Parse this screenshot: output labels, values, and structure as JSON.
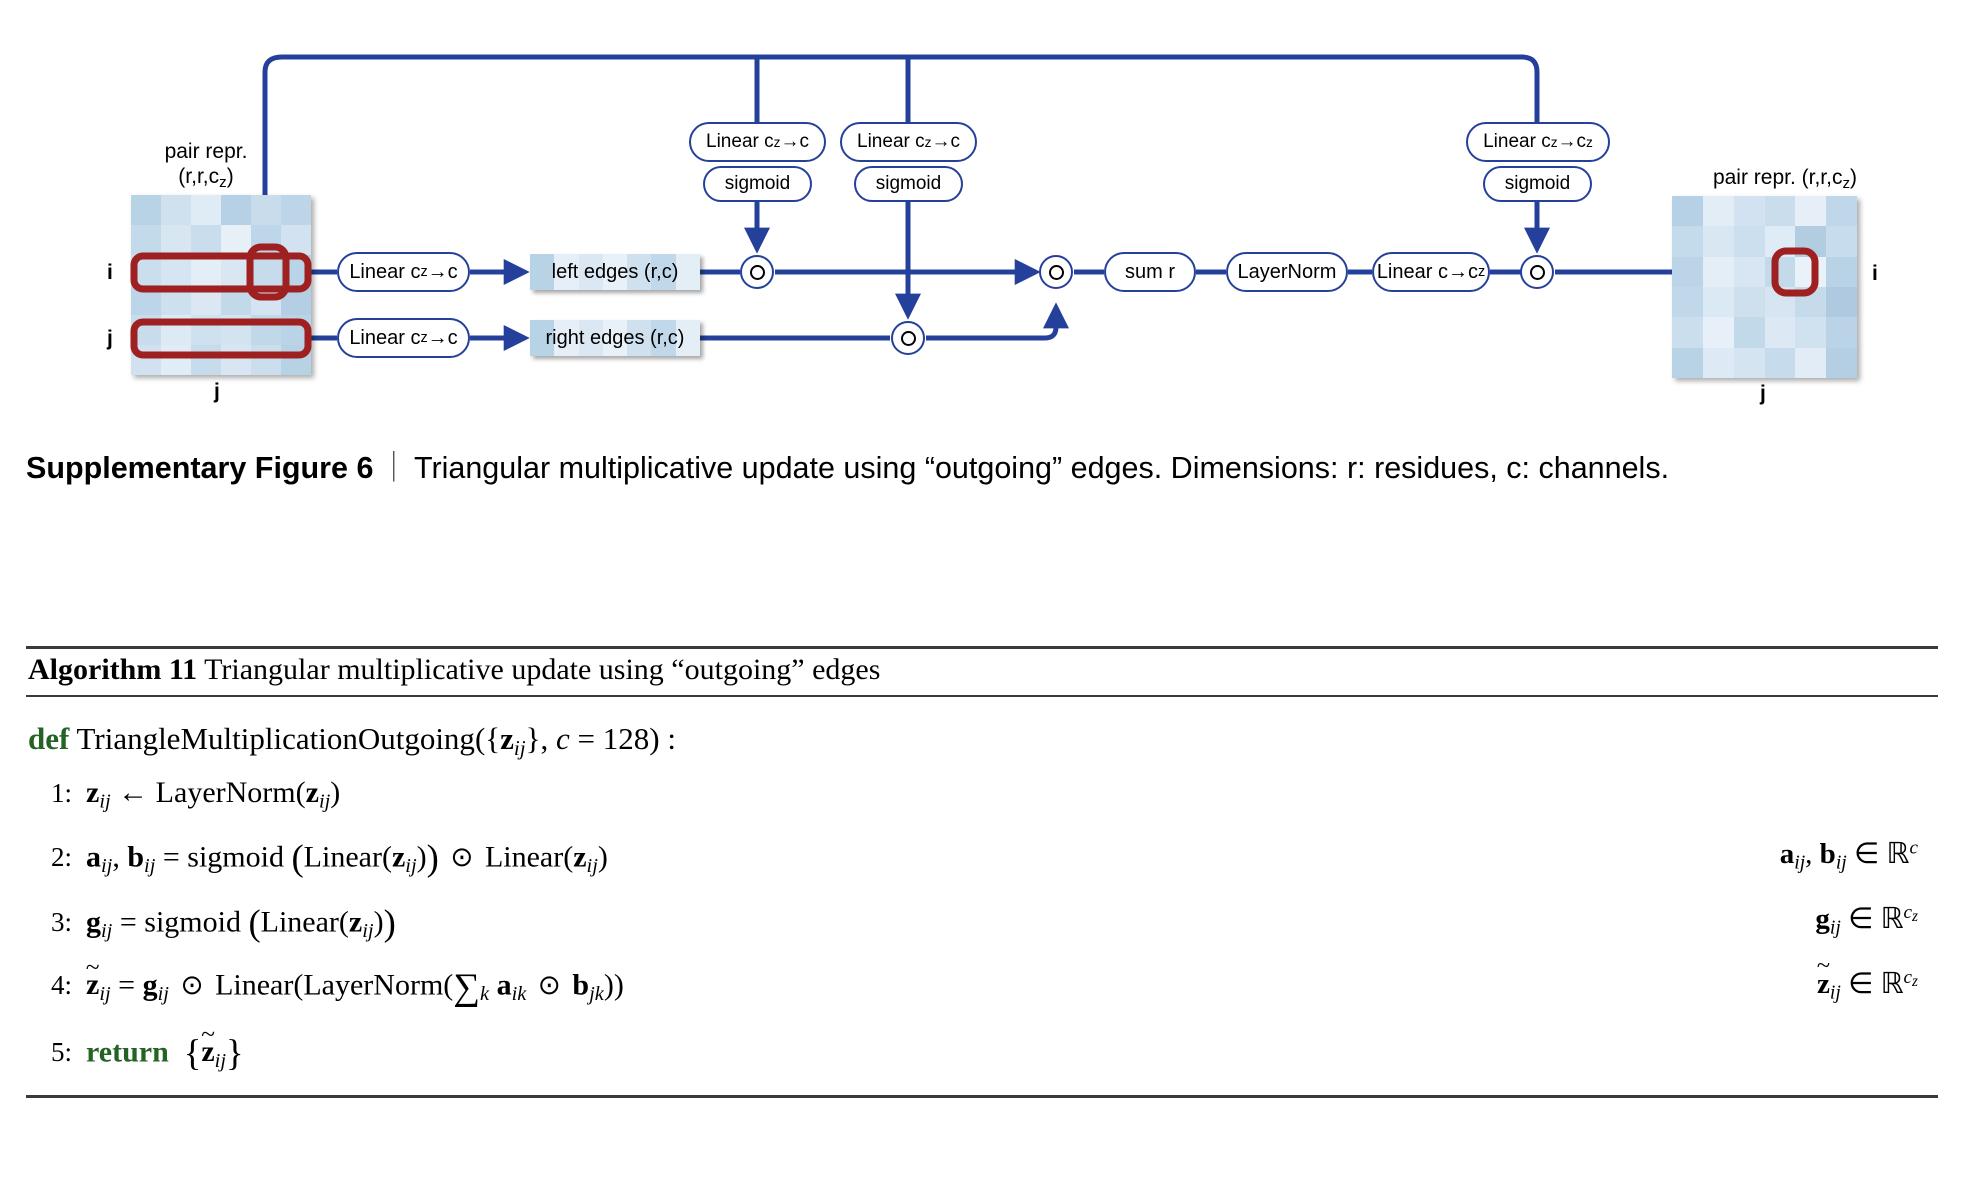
{
  "figure": {
    "diagram": {
      "input_matrix": {
        "title_line1": "pair repr.",
        "title_line2": "(r,r,c",
        "title_sub": "z",
        "title_close": ")",
        "row_label_i": "i",
        "row_label_j": "j",
        "col_label": "j"
      },
      "output_matrix": {
        "title": "pair repr. (r,r,c",
        "title_sub": "z",
        "title_close": ")",
        "row_label_i": "i",
        "col_label": "j"
      },
      "nodes": {
        "linear_left": "Linear c",
        "linear_left_sub": "z",
        "linear_left_tail": "→c",
        "linear_right": "Linear c",
        "linear_right_sub": "z",
        "linear_right_tail": "→c",
        "gate_linear_1": "Linear c",
        "gate_linear_1_sub": "z",
        "gate_linear_1_tail": "→c",
        "gate_linear_2": "Linear c",
        "gate_linear_2_sub": "z",
        "gate_linear_2_tail": "→c",
        "gate_linear_3": "Linear c",
        "gate_linear_3_sub": "z",
        "gate_linear_3_tail": "→c",
        "gate_linear_3_tail_sub": "z",
        "sigmoid_1": "sigmoid",
        "sigmoid_2": "sigmoid",
        "sigmoid_3": "sigmoid",
        "left_edges": "left edges (r,c)",
        "right_edges": "right edges (r,c)",
        "sum_r": "sum r",
        "layernorm": "LayerNorm",
        "linear_out": "Linear c→c",
        "linear_out_sub": "z"
      },
      "colors": {
        "line": "#24409a",
        "highlight": "#9e2020",
        "cell_light": "#e8f0f8",
        "cell_mid": "#c7dceb",
        "cell_dark": "#a9c9df"
      },
      "input_cells": [
        [
          "#b9d3e6",
          "#cfe1ef",
          "#dfebf5",
          "#b6d1e5",
          "#c8dcec",
          "#bdd5e8"
        ],
        [
          "#c3daea",
          "#d8e6f2",
          "#c9dded",
          "#e7f0f7",
          "#bed6e9",
          "#d2e2f0"
        ],
        [
          "#cadeee",
          "#d6e5f2",
          "#e4eef6",
          "#d9e7f3",
          "#c6dbeb",
          "#bad4e7"
        ],
        [
          "#bdd5e8",
          "#cde0ee",
          "#dbe8f4",
          "#c2d9ea",
          "#d5e4f1",
          "#b4cfe3"
        ],
        [
          "#c8dcec",
          "#ddeaf4",
          "#cfe1ef",
          "#d4e3f0",
          "#c1d8e9",
          "#bbd3e7"
        ],
        [
          "#d1e1ef",
          "#e0ecf6",
          "#c6dbeb",
          "#d7e6f2",
          "#cbdeed",
          "#b7d2e5"
        ]
      ],
      "output_cells": [
        [
          "#b6d1e5",
          "#e2edf6",
          "#d3e2f0",
          "#c9ddec",
          "#e6eff7",
          "#bfd7e9"
        ],
        [
          "#c4dbeb",
          "#d9e7f3",
          "#ccdfee",
          "#dfebf5",
          "#b2cde2",
          "#c7dcec"
        ],
        [
          "#bcd4e7",
          "#e4eef6",
          "#d7e6f2",
          "#c3daea",
          "#eaf2f9",
          "#b9d3e6"
        ],
        [
          "#c0d8e9",
          "#dbe9f4",
          "#cedfee",
          "#d6e5f1",
          "#c5dbeb",
          "#aec9e0"
        ],
        [
          "#cadeed",
          "#e7f0f8",
          "#c2d9ea",
          "#dce9f4",
          "#d0e1ef",
          "#bbd3e7"
        ],
        [
          "#b8d2e6",
          "#dde9f5",
          "#d5e4f1",
          "#c6dcec",
          "#e1ecf6",
          "#b4cfe3"
        ]
      ],
      "edge_strip_cells": [
        "#b9d3e6",
        "#e6eff7",
        "#dbe8f4",
        "#e9f1f8",
        "#cfe1ef",
        "#c0d8e9",
        "#e4eef6"
      ]
    },
    "caption": {
      "label": "Supplementary Figure 6",
      "separator": "｜",
      "text": "Triangular multiplicative update using “outgoing” edges. Dimensions: r: residues, c: channels."
    }
  },
  "algorithm": {
    "header_label": "Algorithm 11",
    "header_title": "Triangular multiplicative update using “outgoing” edges",
    "def_keyword": "def",
    "def_name": "TriangleMultiplicationOutgoing",
    "def_args_open": "({",
    "def_arg_z": "z",
    "def_arg_z_sub": "ij",
    "def_args_mid": "}, ",
    "def_c": "c",
    "def_eq": " = 128) :",
    "steps": [
      {
        "num": "1:",
        "body": "z_ij ← LayerNorm(z_ij)",
        "rhs": ""
      },
      {
        "num": "2:",
        "body": "a_ij, b_ij = sigmoid (Linear(z_ij)) ⊙ Linear(z_ij)",
        "rhs": "a_ij, b_ij ∈ R^c"
      },
      {
        "num": "3:",
        "body": "g_ij = sigmoid (Linear(z_ij))",
        "rhs": "g_ij ∈ R^cz"
      },
      {
        "num": "4:",
        "body": "z~_ij = g_ij ⊙ Linear(LayerNorm(∑_k a_ik ⊙ b_jk))",
        "rhs": "z~_ij ∈ R^cz"
      },
      {
        "num": "5:",
        "body": "return {z~_ij}",
        "rhs": ""
      }
    ],
    "return_keyword": "return",
    "colors": {
      "keyword": "#256325",
      "rule": "#3a3a3a"
    }
  }
}
